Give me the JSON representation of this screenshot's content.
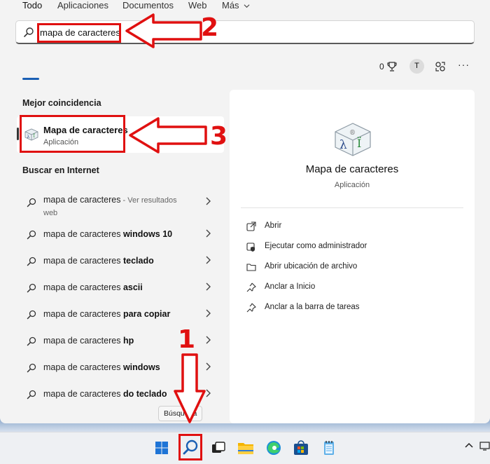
{
  "search": {
    "value": "mapa de caracteres",
    "icon": "search-icon"
  },
  "tabs": [
    {
      "label": "Todo",
      "active": true
    },
    {
      "label": "Aplicaciones"
    },
    {
      "label": "Documentos"
    },
    {
      "label": "Web"
    },
    {
      "label": "Más"
    }
  ],
  "toolbar": {
    "points": "0",
    "avatar_letter": "T",
    "more": "···"
  },
  "best_match": {
    "heading": "Mejor coincidencia",
    "name": "Mapa de caracteres",
    "kind": "Aplicación"
  },
  "internet": {
    "heading": "Buscar en Internet",
    "first": {
      "query": "mapa de caracteres",
      "suffix": " - Ver resultados",
      "line2": "web"
    },
    "items": [
      {
        "base": "mapa de caracteres ",
        "bold": "windows 10"
      },
      {
        "base": "mapa de caracteres ",
        "bold": "teclado"
      },
      {
        "base": "mapa de caracteres ",
        "bold": "ascii"
      },
      {
        "base": "mapa de caracteres ",
        "bold": "para copiar"
      },
      {
        "base": "mapa de caracteres ",
        "bold": "hp"
      },
      {
        "base": "mapa de caracteres ",
        "bold": "windows"
      },
      {
        "base": "mapa de caracteres ",
        "bold": "do teclado"
      }
    ]
  },
  "preview": {
    "title": "Mapa de caracteres",
    "kind": "Aplicación",
    "actions": [
      {
        "label": "Abrir",
        "icon": "open-icon"
      },
      {
        "label": "Ejecutar como administrador",
        "icon": "admin-shield-icon"
      },
      {
        "label": "Abrir ubicación de archivo",
        "icon": "folder-icon"
      },
      {
        "label": "Anclar a Inicio",
        "icon": "pin-icon"
      },
      {
        "label": "Anclar a la barra de tareas",
        "icon": "pin-icon"
      }
    ]
  },
  "tooltip": "Búsqueda",
  "annotations": {
    "n1": "1",
    "n2": "2",
    "n3": "3",
    "color": "#e01010"
  },
  "taskbar": [
    "start-icon",
    "search-icon",
    "task-view-icon",
    "file-explorer-icon",
    "edge-icon",
    "store-icon",
    "notepad-icon"
  ]
}
